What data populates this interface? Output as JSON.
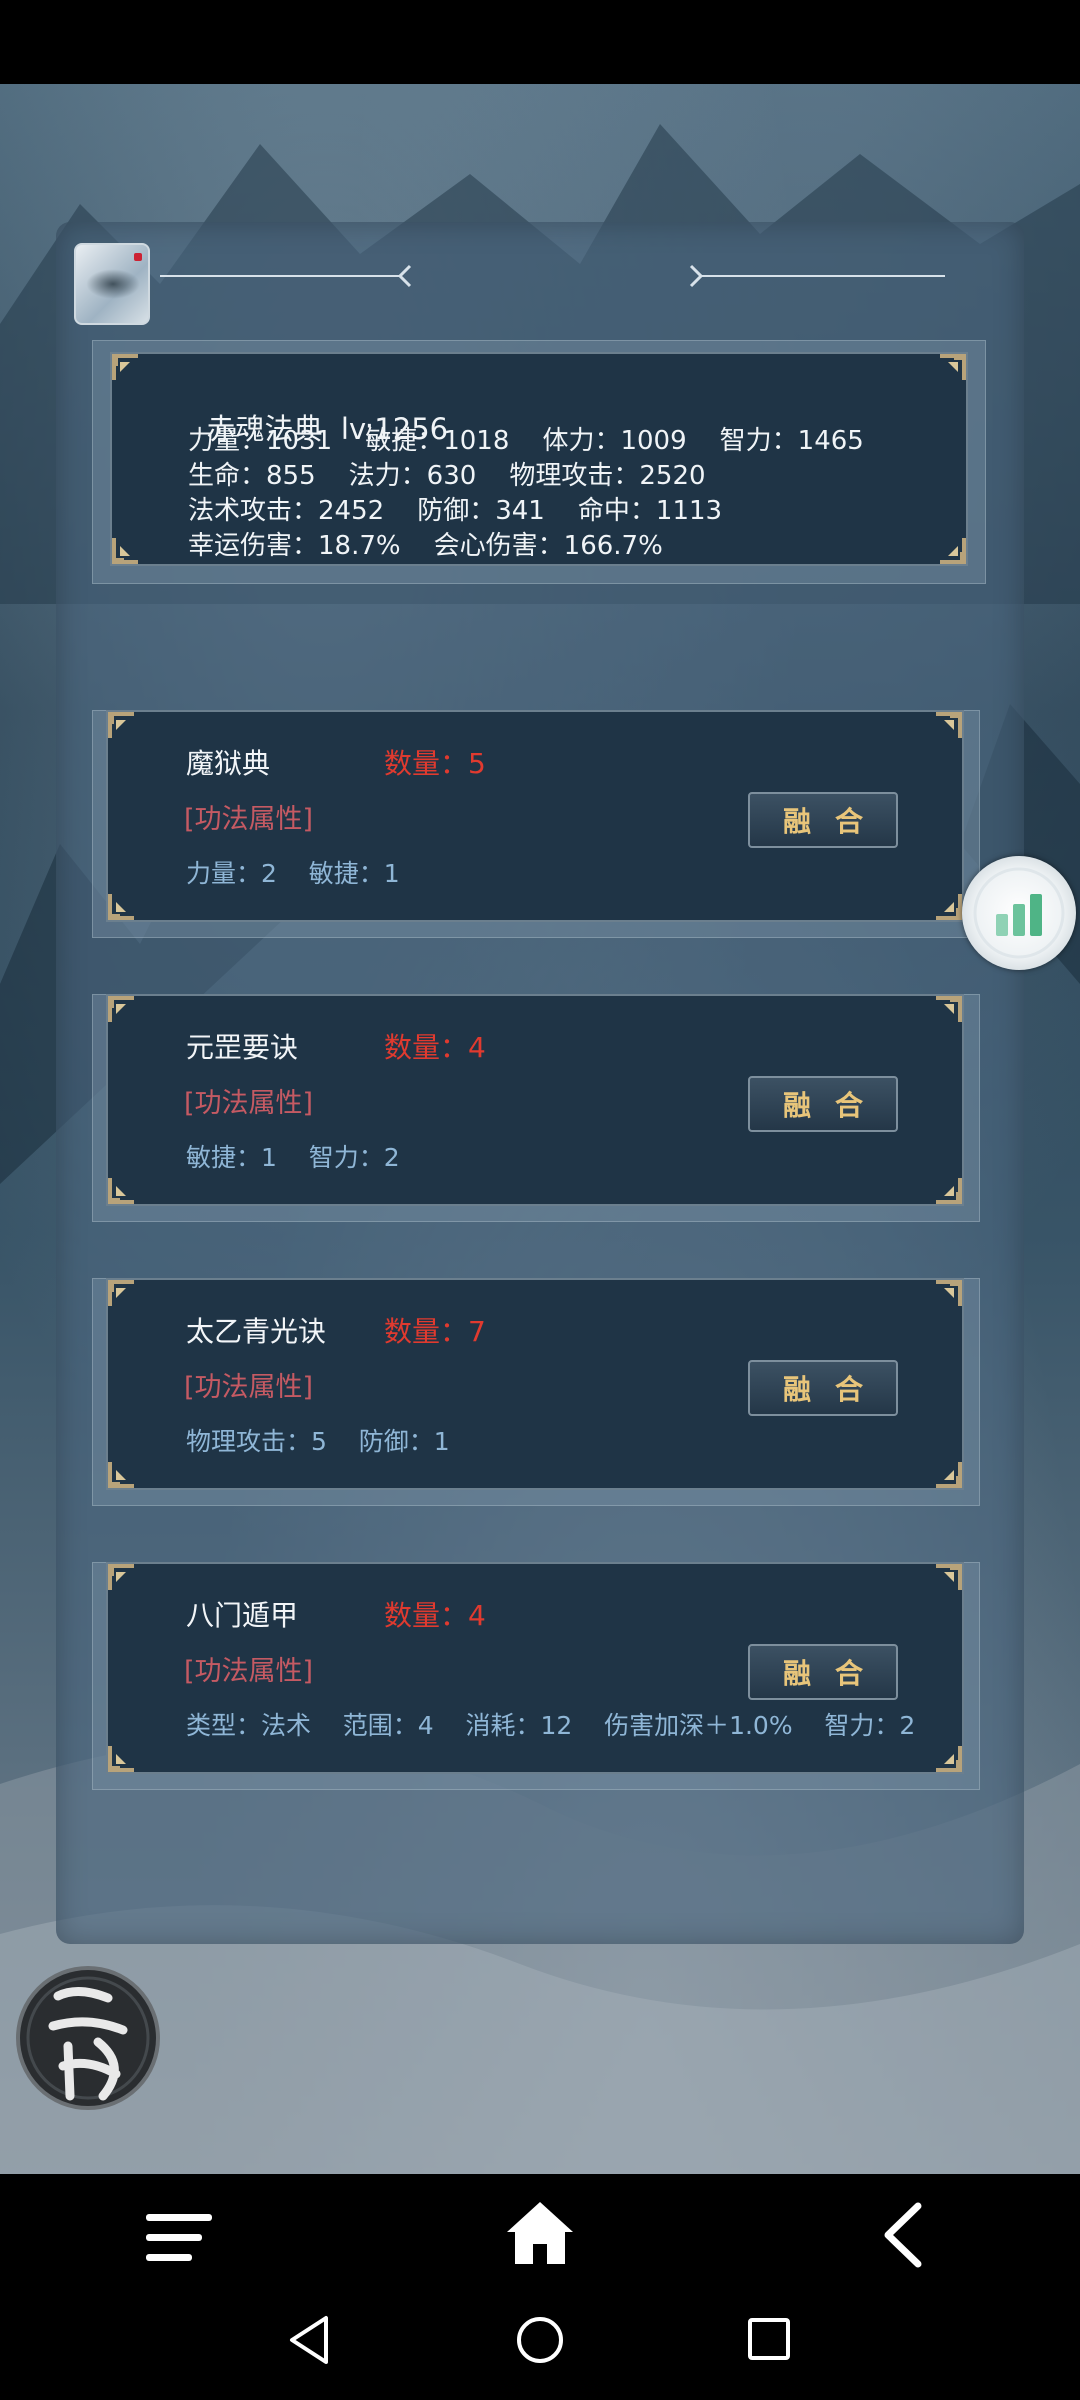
{
  "summary": {
    "name": "赤魂法典",
    "level": "lv:1256",
    "line1": "力量：1031    敏捷：1018    体力：1009    智力：1465",
    "line2": "生命：855    法力：630    物理攻击：2520",
    "line3": "法术攻击：2452    防御：341    命中：1113",
    "line4": "幸运伤害：18.7%    会心伤害：166.7%"
  },
  "items": [
    {
      "name": "魔狱典",
      "count": "数量：5",
      "attr": "[功法属性]",
      "stats": "力量：2    敏捷：1",
      "button": "融合"
    },
    {
      "name": "元罡要诀",
      "count": "数量：4",
      "attr": "[功法属性]",
      "stats": "敏捷：1    智力：2",
      "button": "融合"
    },
    {
      "name": "太乙青光诀",
      "count": "数量：7",
      "attr": "[功法属性]",
      "stats": "物理攻击：5    防御：1",
      "button": "融合"
    },
    {
      "name": "八门遁甲",
      "count": "数量：4",
      "attr": "[功法属性]",
      "stats": "类型：法术    范围：4    消耗：12    伤害加深＋1.0%    智力：2",
      "button": "融合"
    }
  ],
  "icons": {
    "avatar": "scroll-avatar-icon",
    "side": "bar-chart-icon",
    "back": "return-seal-icon",
    "menu": "menu-icon",
    "home": "home-icon",
    "back_nav": "chevron-left-icon",
    "sys_back": "triangle-back-icon",
    "sys_home": "circle-home-icon",
    "sys_recent": "square-recents-icon"
  },
  "colors": {
    "count": "#e03a2f",
    "attr": "#c55a63",
    "stats": "#8fb6d6",
    "button_text": "#e8c57a",
    "card_bg": "#1f3446"
  }
}
